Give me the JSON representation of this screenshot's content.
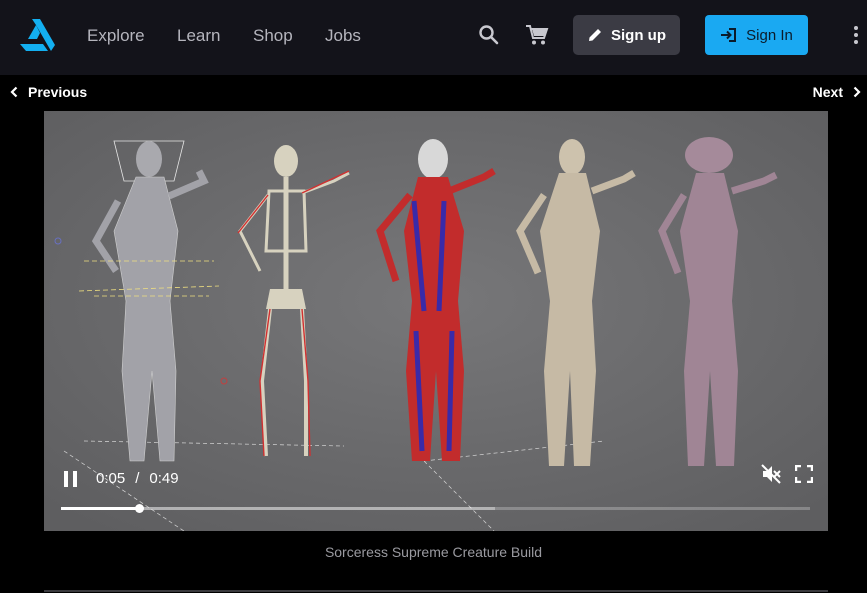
{
  "nav": {
    "links": [
      "Explore",
      "Learn",
      "Shop",
      "Jobs"
    ],
    "signup_label": "Sign up",
    "signin_label": "Sign In",
    "accent": "#1aa9f2",
    "icons": [
      "search-icon",
      "cart-icon",
      "pencil-icon",
      "login-icon",
      "more-vert-icon"
    ]
  },
  "pager": {
    "previous_label": "Previous",
    "next_label": "Next"
  },
  "video": {
    "current_time": "0:05",
    "separator": "/",
    "duration": "0:49",
    "played_fraction": 0.104,
    "buffered_fraction": 0.58,
    "muted": true,
    "state": "playing"
  },
  "caption": "Sorceress Supreme Creature Build"
}
